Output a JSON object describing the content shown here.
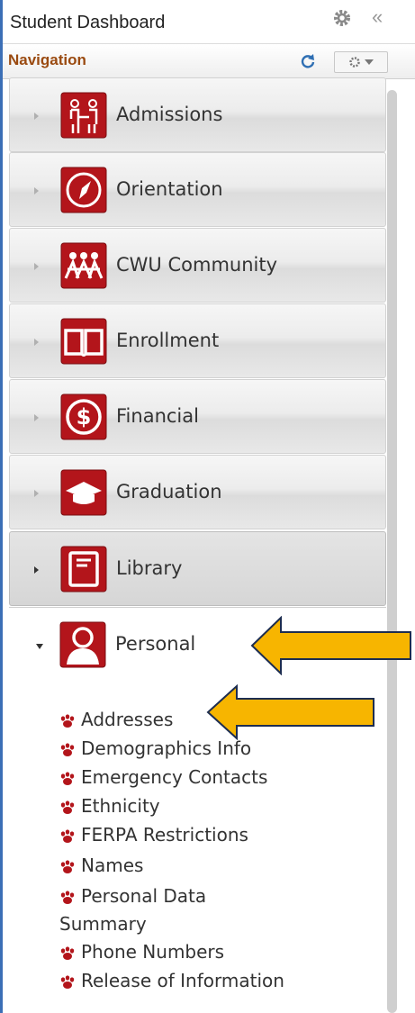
{
  "header": {
    "title": "Student Dashboard",
    "gear_icon": "gear-icon",
    "collapse_glyph": "«"
  },
  "navbar": {
    "label": "Navigation",
    "refresh_icon": "refresh-icon",
    "menu_icon": "gear-dropdown-icon"
  },
  "colors": {
    "brand_red": "#b3151b",
    "nav_label": "#9a4a10",
    "callout_arrow": "#f7b500"
  },
  "nav_items": [
    {
      "label": "Admissions",
      "icon": "people-handshake-icon",
      "state": "collapsed"
    },
    {
      "label": "Orientation",
      "icon": "compass-icon",
      "state": "collapsed"
    },
    {
      "label": "CWU Community",
      "icon": "community-people-icon",
      "state": "collapsed"
    },
    {
      "label": "Enrollment",
      "icon": "open-book-icon",
      "state": "collapsed"
    },
    {
      "label": "Financial",
      "icon": "dollar-icon",
      "state": "collapsed"
    },
    {
      "label": "Graduation",
      "icon": "graduation-cap-icon",
      "state": "collapsed"
    },
    {
      "label": "Library",
      "icon": "library-book-icon",
      "state": "collapsed-hover"
    },
    {
      "label": "Personal",
      "icon": "person-icon",
      "state": "expanded"
    }
  ],
  "personal_links": [
    "Addresses",
    "Demographics Info",
    "Emergency Contacts",
    "Ethnicity",
    "FERPA Restrictions",
    "Names",
    "Personal Data",
    "Summary",
    "Phone Numbers",
    "Release of Information"
  ]
}
